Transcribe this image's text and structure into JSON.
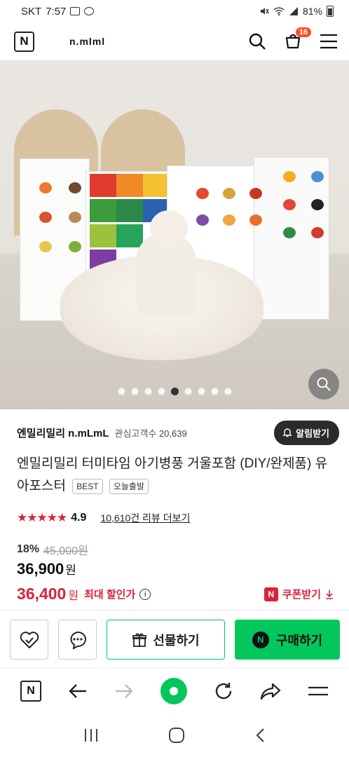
{
  "status_bar": {
    "carrier": "SKT",
    "time": "7:57",
    "battery": "81%"
  },
  "header": {
    "logo": "N",
    "brand": "n.mlml",
    "cart_count": "16"
  },
  "gallery": {
    "total_slides": 9,
    "active_slide": 5
  },
  "store": {
    "name": "엔밀리밀리 n.mLmL",
    "fans_label": "관심고객수",
    "fans_count": "20,639",
    "alarm_label": "알림받기"
  },
  "product": {
    "title": "엔밀리밀리 터미타임 아기병풍 거울포함 (DIY/완제품) 유아포스터",
    "tags": [
      "BEST",
      "오늘출발"
    ],
    "rating": "4.9",
    "stars": 5,
    "review_text": "10,610건 리뷰 더보기",
    "discount_pct": "18%",
    "original_price": "45,000원",
    "sale_price": "36,900",
    "sale_unit": "원",
    "max_discount_price": "36,400",
    "max_unit": "원",
    "max_label": "최대 할인가",
    "coupon_label": "쿠폰받기"
  },
  "actions": {
    "gift_label": "선물하기",
    "buy_label": "구매하기"
  },
  "colors": {
    "naver_green": "#03c75a",
    "accent_red": "#d6243b",
    "badge_orange": "#ff4b2b"
  },
  "icons": [
    "search-icon",
    "cart-icon",
    "menu-icon",
    "zoom-icon",
    "bell-icon",
    "wishlist-icon",
    "chat-icon",
    "gift-icon",
    "back-icon",
    "forward-icon",
    "refresh-icon",
    "share-icon"
  ]
}
